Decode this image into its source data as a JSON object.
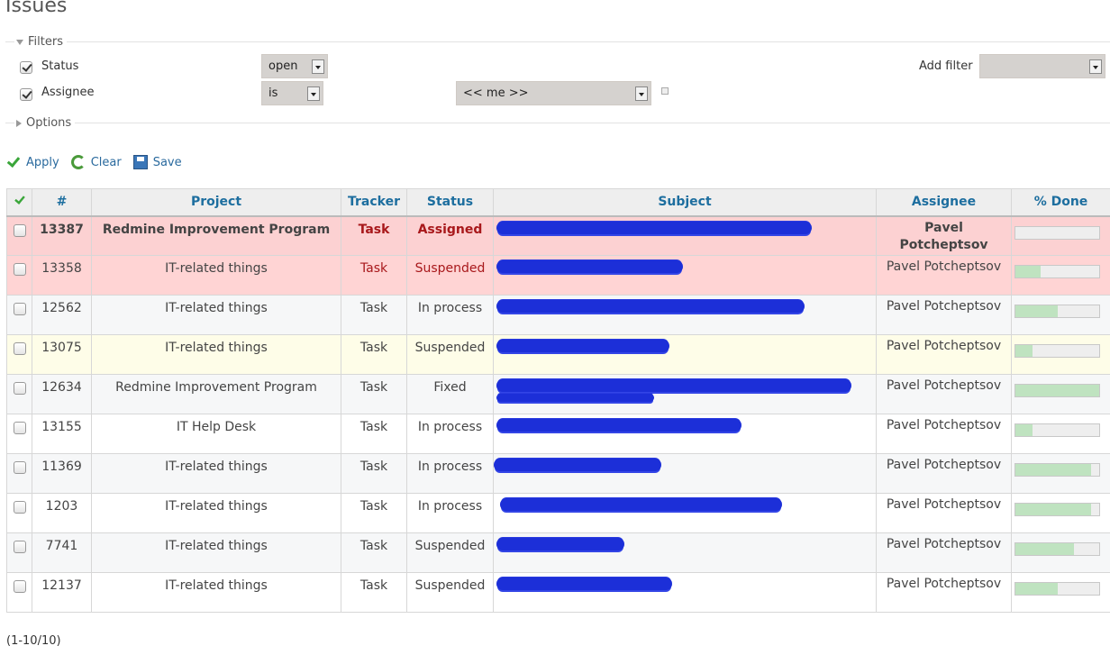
{
  "page": {
    "title": "Issues"
  },
  "filters": {
    "legend": "Filters",
    "add_filter_label": "Add filter",
    "add_filter_value": "",
    "rows": [
      {
        "label": "Status",
        "checked": true,
        "operator": "open",
        "value": ""
      },
      {
        "label": "Assignee",
        "checked": true,
        "operator": "is",
        "value": "<< me >>"
      }
    ]
  },
  "options": {
    "legend": "Options"
  },
  "actions": {
    "apply": "Apply",
    "clear": "Clear",
    "save": "Save"
  },
  "table": {
    "columns": [
      "#",
      "Project",
      "Tracker",
      "Status",
      "Subject",
      "Assignee",
      "% Done"
    ],
    "rows": [
      {
        "id": "13387",
        "project": "Redmine Improvement Program",
        "tracker": "Task",
        "status": "Assigned",
        "subject": "",
        "assignee": "Pavel Potcheptsov",
        "done": 0,
        "style": "p-high bold"
      },
      {
        "id": "13358",
        "project": "IT-related things",
        "tracker": "Task",
        "status": "Suspended",
        "subject": "",
        "assignee": "Pavel Potcheptsov",
        "done": 30,
        "style": "p-med"
      },
      {
        "id": "12562",
        "project": "IT-related things",
        "tracker": "Task",
        "status": "In process",
        "subject": "",
        "assignee": "Pavel Potcheptsov",
        "done": 50,
        "style": "even"
      },
      {
        "id": "13075",
        "project": "IT-related things",
        "tracker": "Task",
        "status": "Suspended",
        "subject": "",
        "assignee": "Pavel Potcheptsov",
        "done": 20,
        "style": "p-low"
      },
      {
        "id": "12634",
        "project": "Redmine Improvement Program",
        "tracker": "Task",
        "status": "Fixed",
        "subject": "",
        "assignee": "Pavel Potcheptsov",
        "done": 100,
        "style": "even"
      },
      {
        "id": "13155",
        "project": "IT Help Desk",
        "tracker": "Task",
        "status": "In process",
        "subject": "",
        "assignee": "Pavel Potcheptsov",
        "done": 20,
        "style": "odd"
      },
      {
        "id": "11369",
        "project": "IT-related things",
        "tracker": "Task",
        "status": "In process",
        "subject": "",
        "assignee": "Pavel Potcheptsov",
        "done": 90,
        "style": "even"
      },
      {
        "id": "1203",
        "project": "IT-related things",
        "tracker": "Task",
        "status": "In process",
        "subject": "",
        "assignee": "Pavel Potcheptsov",
        "done": 90,
        "style": "odd"
      },
      {
        "id": "7741",
        "project": "IT-related things",
        "tracker": "Task",
        "status": "Suspended",
        "subject": "",
        "assignee": "Pavel Potcheptsov",
        "done": 70,
        "style": "even"
      },
      {
        "id": "12137",
        "project": "IT-related things",
        "tracker": "Task",
        "status": "Suspended",
        "subject": "",
        "assignee": "Pavel Potcheptsov",
        "done": 50,
        "style": "odd"
      }
    ]
  },
  "pagination": {
    "text": "(1-10/10)"
  }
}
